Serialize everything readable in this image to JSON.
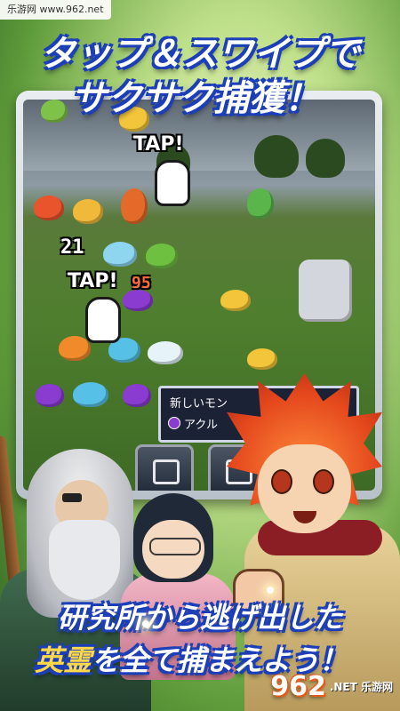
{
  "watermark_top": "乐游网 www.962.net",
  "headline": {
    "line1": "タップ＆スワイプで",
    "line2": "サクサク捕獲！"
  },
  "game": {
    "tap_label_1": "TAP!",
    "tap_label_2": "TAP!",
    "damage_1": "21",
    "damage_2": "95",
    "dialog": {
      "line1": "新しいモン",
      "line2": "アクル"
    }
  },
  "bottom_text": {
    "line1": "研究所から逃げ出した",
    "line2_highlight": "英霊",
    "line2_rest": "を全て捕まえよう！"
  },
  "watermark_bottom": {
    "big": "962",
    "small": ".NET 乐游网"
  },
  "colors": {
    "headline_outline": "#1c3fb8",
    "highlight": "#ffd84a",
    "hero_hair": "#e4471c"
  }
}
